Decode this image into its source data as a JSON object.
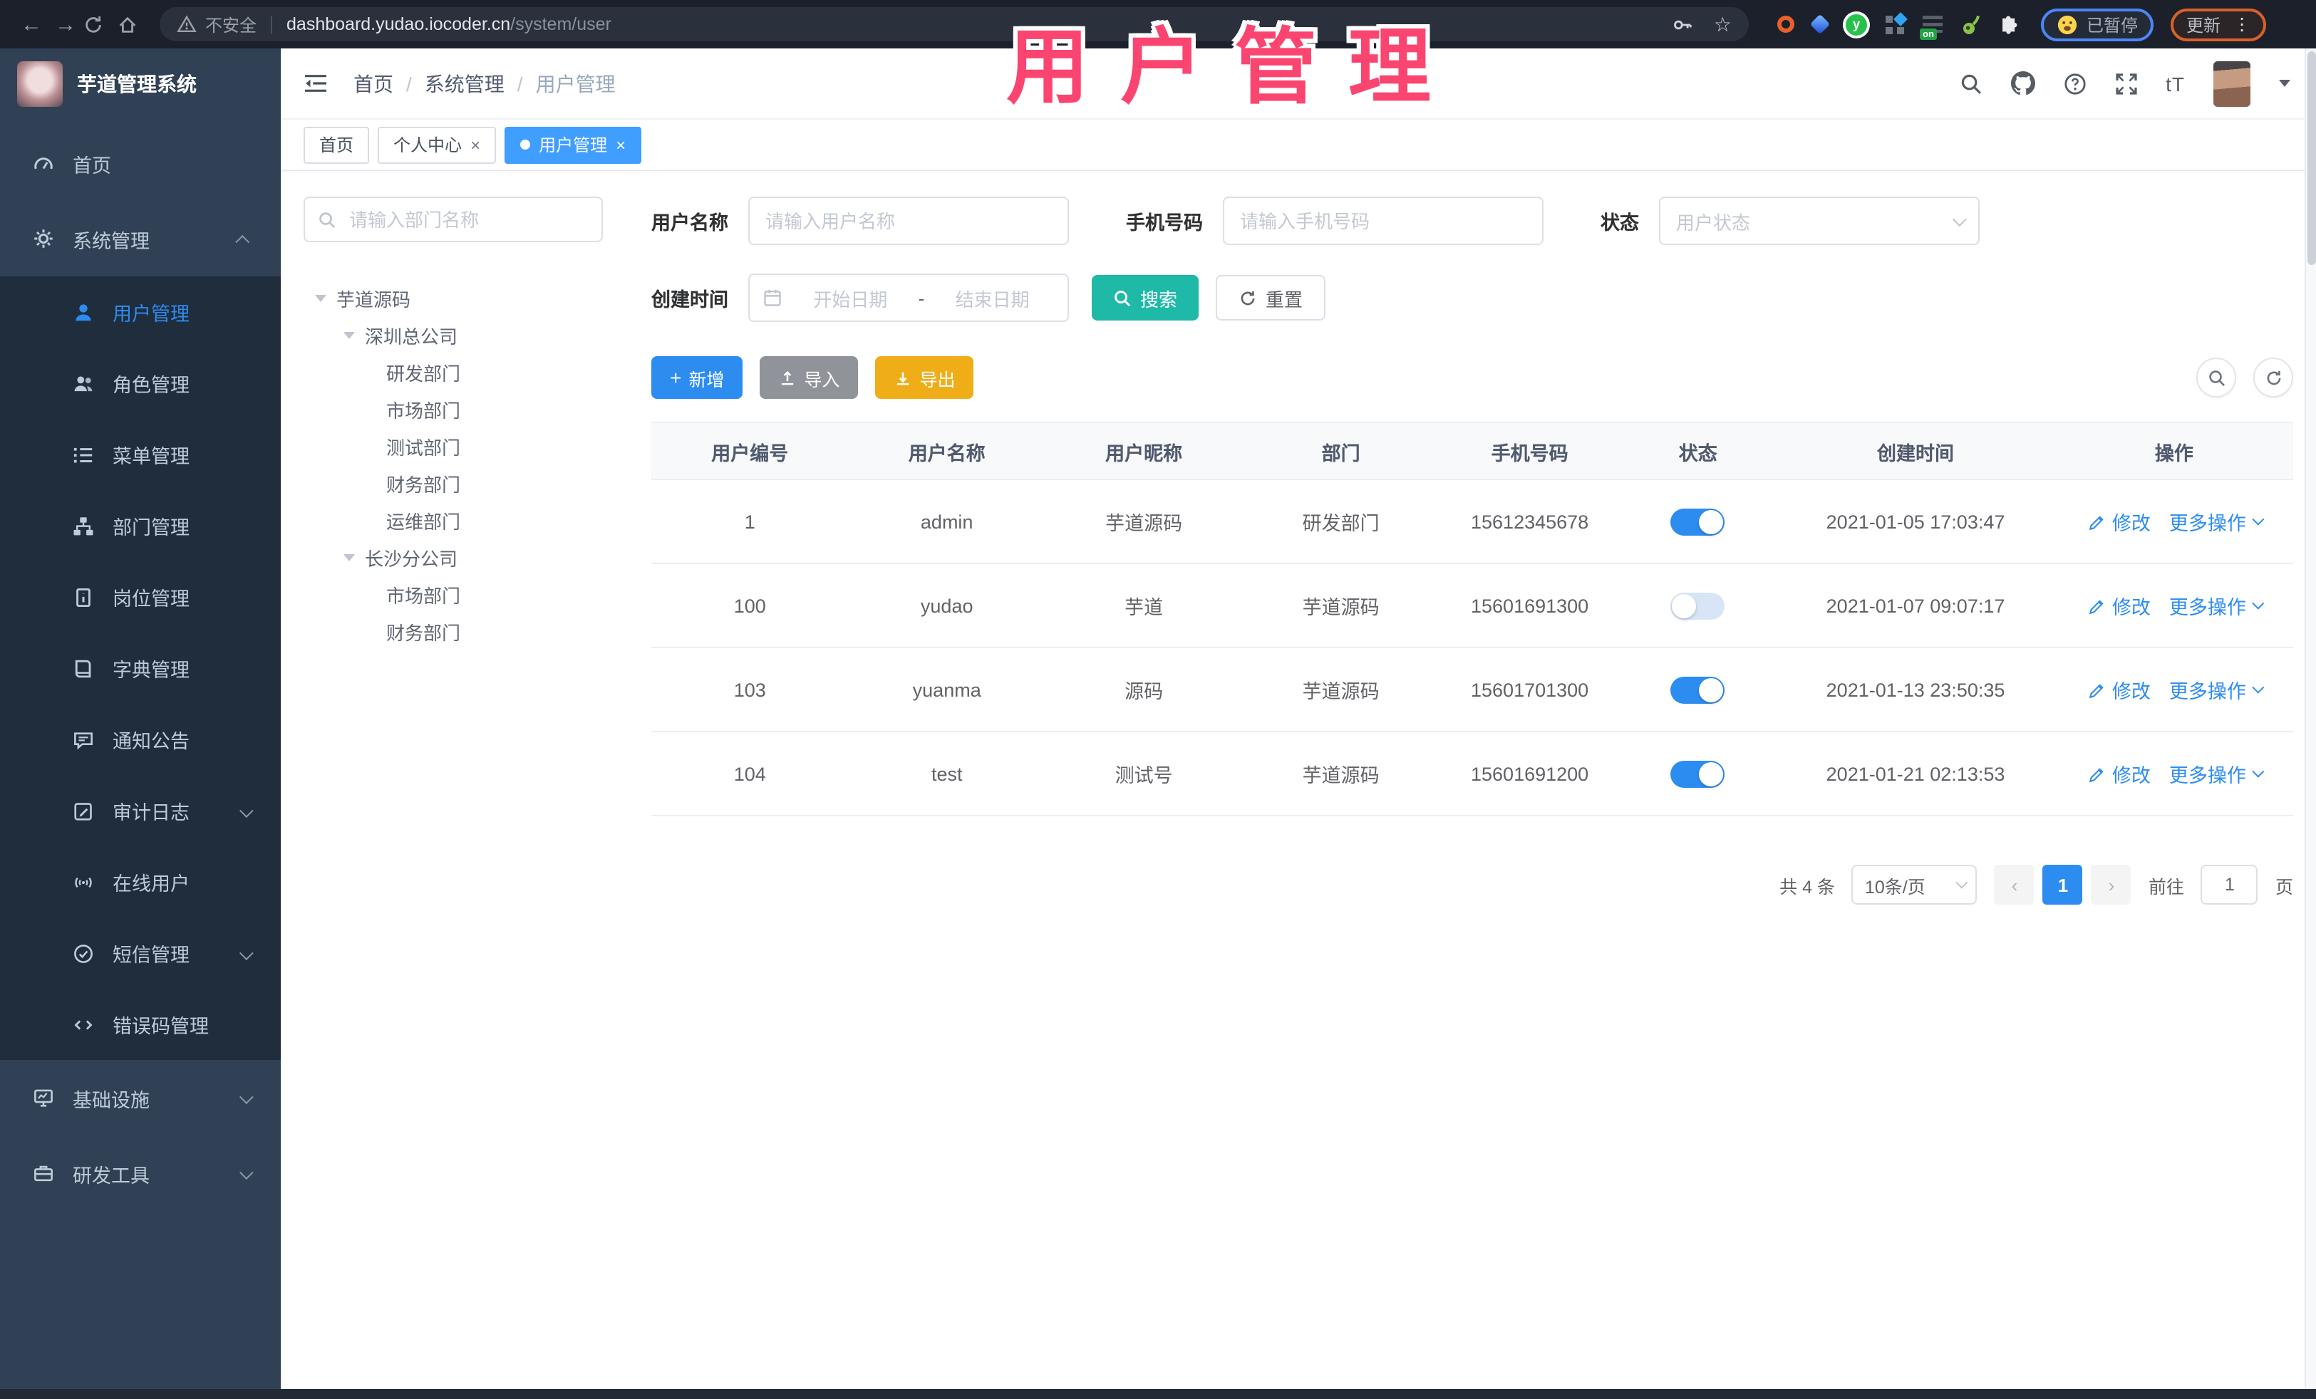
{
  "colors": {
    "accent_blue": "#2d8cf0",
    "active_tab_blue": "#409eff",
    "search_teal": "#1eb9a7",
    "import_gray": "#909399",
    "export_gold": "#efad18",
    "overlay_pink": "#fb4571",
    "sidebar_bg": "#304156",
    "submenu_bg": "#1f2d3d"
  },
  "browser": {
    "security_label": "不安全",
    "url_host": "dashboard.yudao.iocoder.cn",
    "url_path": "/system/user",
    "extension_on_badge": "on",
    "paused_badge": "已暂停",
    "update_label": "更新"
  },
  "header": {
    "logo_title": "芋道管理系统",
    "breadcrumb": {
      "home": "首页",
      "section": "系统管理",
      "current": "用户管理",
      "separator": "/"
    },
    "font_icon_label": "tT"
  },
  "tabs": {
    "tab1": "首页",
    "tab2": "个人中心",
    "tab3": "用户管理",
    "close": "×"
  },
  "overlay": {
    "title": "用户管理"
  },
  "sidebar": {
    "items": [
      {
        "label": "首页"
      },
      {
        "label": "系统管理"
      },
      {
        "label": "用户管理"
      },
      {
        "label": "角色管理"
      },
      {
        "label": "菜单管理"
      },
      {
        "label": "部门管理"
      },
      {
        "label": "岗位管理"
      },
      {
        "label": "字典管理"
      },
      {
        "label": "通知公告"
      },
      {
        "label": "审计日志"
      },
      {
        "label": "在线用户"
      },
      {
        "label": "短信管理"
      },
      {
        "label": "错误码管理"
      },
      {
        "label": "基础设施"
      },
      {
        "label": "研发工具"
      }
    ]
  },
  "dept": {
    "search_placeholder": "请输入部门名称",
    "tree": [
      {
        "label": "芋道源码"
      },
      {
        "label": "深圳总公司"
      },
      {
        "label": "研发部门"
      },
      {
        "label": "市场部门"
      },
      {
        "label": "测试部门"
      },
      {
        "label": "财务部门"
      },
      {
        "label": "运维部门"
      },
      {
        "label": "长沙分公司"
      },
      {
        "label": "市场部门"
      },
      {
        "label": "财务部门"
      }
    ]
  },
  "filter": {
    "username_label": "用户名称",
    "username_placeholder": "请输入用户名称",
    "mobile_label": "手机号码",
    "mobile_placeholder": "请输入手机号码",
    "status_label": "状态",
    "status_placeholder": "用户状态",
    "date_label": "创建时间",
    "date_start_placeholder": "开始日期",
    "date_separator": "-",
    "date_end_placeholder": "结束日期",
    "search_label": "搜索",
    "reset_label": "重置"
  },
  "toolbar": {
    "add_label": "新增",
    "import_label": "导入",
    "export_label": "导出"
  },
  "table": {
    "columns": [
      "用户编号",
      "用户名称",
      "用户昵称",
      "部门",
      "手机号码",
      "状态",
      "创建时间",
      "操作"
    ],
    "actions": {
      "edit": "修改",
      "more": "更多操作"
    },
    "rows": [
      {
        "id": "1",
        "username": "admin",
        "nickname": "芋道源码",
        "dept": "研发部门",
        "mobile": "15612345678",
        "status": true,
        "created": "2021-01-05 17:03:47"
      },
      {
        "id": "100",
        "username": "yudao",
        "nickname": "芋道",
        "dept": "芋道源码",
        "mobile": "15601691300",
        "status": false,
        "created": "2021-01-07 09:07:17"
      },
      {
        "id": "103",
        "username": "yuanma",
        "nickname": "源码",
        "dept": "芋道源码",
        "mobile": "15601701300",
        "status": true,
        "created": "2021-01-13 23:50:35"
      },
      {
        "id": "104",
        "username": "test",
        "nickname": "测试号",
        "dept": "芋道源码",
        "mobile": "15601691200",
        "status": true,
        "created": "2021-01-21 02:13:53"
      }
    ]
  },
  "pagination": {
    "total": "共 4 条",
    "page_size": "10条/页",
    "prev": "‹",
    "page": "1",
    "next": "›",
    "goto_prefix": "前往",
    "goto_value": "1",
    "goto_suffix": "页"
  }
}
